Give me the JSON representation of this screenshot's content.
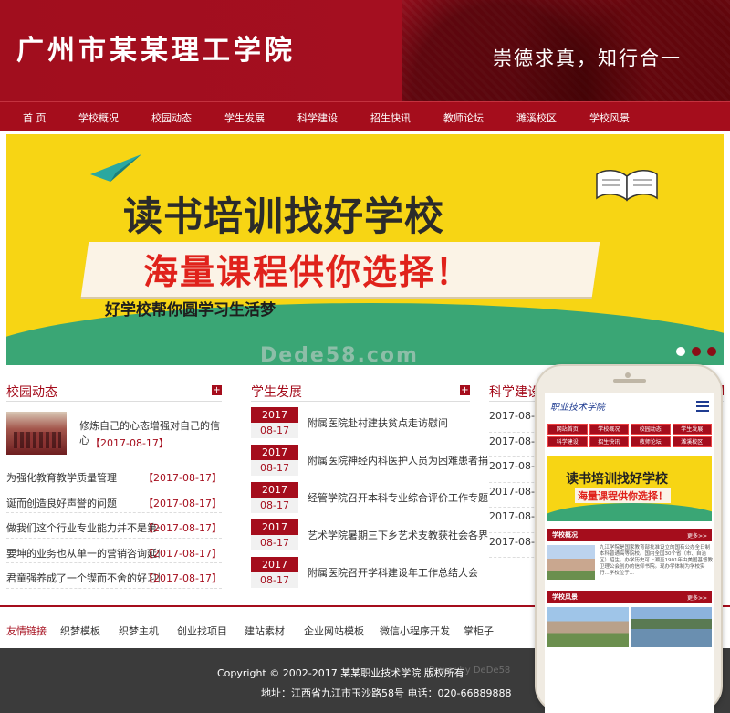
{
  "header": {
    "site_title": "广州市某某理工学院",
    "motto": "崇德求真，知行合一"
  },
  "nav": {
    "items": [
      "首 页",
      "学校概况",
      "校园动态",
      "学生发展",
      "科学建设",
      "招生快讯",
      "教师论坛",
      "濉溪校区",
      "学校风景"
    ]
  },
  "banner": {
    "line1": "读书培训找好学校",
    "line2": "海量课程供你选择！",
    "line3": "好学校帮你圆学习生活梦",
    "active_slide": 1,
    "slide_count": 3
  },
  "watermark": "Dede58.com",
  "campus_news": {
    "title": "校园动态",
    "more": "+",
    "featured": {
      "text": "修炼自己的心态增强对自己的信心",
      "date": "【2017-08-17】"
    },
    "items": [
      {
        "title": "为强化教育教学质量管理",
        "date": "【2017-08-17】"
      },
      {
        "title": "诞而创造良好声誉的问题",
        "date": "【2017-08-17】"
      },
      {
        "title": "做我们这个行业专业能力并不是第一重",
        "date": "【2017-08-17】"
      },
      {
        "title": "要坤的业务也从单一的营销咨询延伸到",
        "date": "【2017-08-17】"
      },
      {
        "title": "君童强养成了一个锲而不舍的好习惯",
        "date": "【2017-08-17】"
      }
    ]
  },
  "student_dev": {
    "title": "学生发展",
    "more": "+",
    "items": [
      {
        "year": "2017",
        "md": "08-17",
        "title": "附属医院赴村建扶贫点走访慰问"
      },
      {
        "year": "2017",
        "md": "08-17",
        "title": "附属医院神经内科医护人员为困难患者捐"
      },
      {
        "year": "2017",
        "md": "08-17",
        "title": "经管学院召开本科专业综合评价工作专题"
      },
      {
        "year": "2017",
        "md": "08-17",
        "title": "艺术学院暑期三下乡艺术支教获社会各界"
      },
      {
        "year": "2017",
        "md": "08-17",
        "title": "附属医院召开学科建设年工作总结大会"
      }
    ]
  },
  "science": {
    "title": "科学建设",
    "more": "+",
    "items": [
      "2017-08-17",
      "2017-08-17",
      "2017-08-17",
      "2017-08-17",
      "2017-08-17",
      "2017-08-17"
    ]
  },
  "links": {
    "label": "友情链接",
    "items": [
      "织梦模板",
      "织梦主机",
      "创业找项目",
      "建站素材",
      "企业网站模板",
      "微信小程序开发",
      "掌柜子"
    ]
  },
  "footer": {
    "copyright": "Copyright © 2002-2017 某某职业技术学院 版权所有",
    "powered": "Power by DeDe58",
    "address": "地址：江西省九江市玉沙路58号 电话：020-66889888"
  },
  "mobile": {
    "logo": "职业技术学院",
    "nav": [
      "网站首页",
      "学校概况",
      "校园动态",
      "学生发展",
      "科学建设",
      "招生快讯",
      "教师论坛",
      "濉溪校区"
    ],
    "banner_a": "读书培训找好学校",
    "banner_b": "海量课程供你选择！",
    "sec1": "学校概况",
    "sec1_more": "更多>>",
    "sec1_text": "九江学院是国家教育部批准设立的国有公办全日制本科普通高等院校。国内全国30个省（市、自治区）招生。办学历史可上溯至1901年由美国基督教卫理公会创办的信仰书院。现办学体制为学校实行...学校位于...",
    "sec2": "学校风景",
    "sec2_more": "更多>>"
  },
  "colors": {
    "brand": "#a50d1c",
    "banner_yellow": "#f7d514",
    "banner_green": "#3aa675",
    "footer": "#3b3b3b"
  }
}
